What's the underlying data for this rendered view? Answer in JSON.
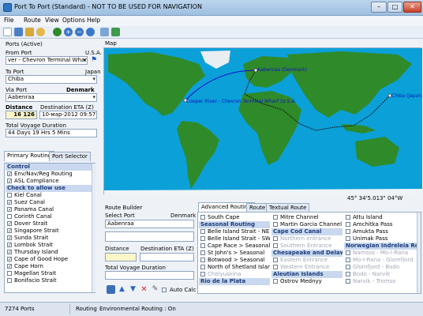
{
  "window": {
    "title": "Port To Port  (Standard)  - NOT TO BE USED FOR NAVIGATION",
    "min": "–",
    "max": "□",
    "close": "✕"
  },
  "menu": [
    "File",
    "Route",
    "View",
    "Options",
    "Help"
  ],
  "ports": {
    "section_label": "Ports (Active)",
    "from_label": "From Port",
    "from_country": "U.S.A.",
    "from_value": "ver - Chevron Terminal Wharf",
    "to_label": "To Port",
    "to_country": "Japan",
    "to_value": "Chiba",
    "via_label": "Via Port",
    "via_country": "Denmark",
    "via_value": "Aabenraa",
    "distance_label": "Distance",
    "distance_value": "16 126",
    "eta_label": "Destination ETA (Z)",
    "eta_value": "10-мар-2012 09:57",
    "duration_label": "Total Voyage Duration",
    "duration_value": "44 Days 19 Hrs 5 Mins"
  },
  "left_tabs": [
    "Primary Routing",
    "Port Selector"
  ],
  "routing_list": [
    {
      "label": "Control",
      "header": true
    },
    {
      "label": "Env/Nav/Reg Routing",
      "checked": true
    },
    {
      "label": "ASL Compliance",
      "checked": true
    },
    {
      "label": "Check to allow use",
      "header": true
    },
    {
      "label": "Kiel Canal",
      "checked": false
    },
    {
      "label": "Suez Canal",
      "checked": true
    },
    {
      "label": "Panama Canal",
      "checked": true
    },
    {
      "label": "Corinth Canal",
      "checked": false
    },
    {
      "label": "Dover Strait",
      "checked": true
    },
    {
      "label": "Singapore Strait",
      "checked": true
    },
    {
      "label": "Sunda Strait",
      "checked": true
    },
    {
      "label": "Lombok Strait",
      "checked": true
    },
    {
      "label": "Thursday Island",
      "checked": true
    },
    {
      "label": "Cape of Good Hope",
      "checked": true
    },
    {
      "label": "Cape Horn",
      "checked": true
    },
    {
      "label": "Magellan Strait",
      "checked": false
    },
    {
      "label": "Bonifacio Strait",
      "checked": false
    }
  ],
  "map": {
    "label": "Map",
    "coordinates": "45° 34'5.013\" 04°W",
    "port_labels": {
      "origin": "Cooper River - Chevron Terminal Wharf (U.S.A.",
      "via": "Aabenraa (Denmark)",
      "destination": "Chiba (Japan"
    }
  },
  "route_builder": {
    "label": "Route Builder",
    "select_port_label": "Select Port",
    "country": "Denmark",
    "port_value": "Aabenraa",
    "distance_label": "Distance",
    "eta_label": "Destination ETA (Z)",
    "duration_label": "Total Voyage Duration",
    "auto_calc_label": "Auto Calc"
  },
  "right_tabs": [
    "Advanced Routing",
    "Route",
    "Textual Route"
  ],
  "grid": {
    "col1": [
      {
        "label": "South Cape",
        "type": "item"
      },
      {
        "label": "Seasonal Routing",
        "type": "header"
      },
      {
        "label": "Belle Island Strait - NE Bound",
        "type": "item"
      },
      {
        "label": "Belle Island Strait - SW Bound",
        "type": "item"
      },
      {
        "label": "Cape Race > Seasonal",
        "type": "item"
      },
      {
        "label": "St John's > Seasonal",
        "type": "item"
      },
      {
        "label": "Botwood > Seasonal",
        "type": "item"
      },
      {
        "label": "North of Shetland Islands",
        "type": "item"
      },
      {
        "label": "Chelyuskina",
        "type": "disabled"
      },
      {
        "label": "Rio de la Plata",
        "type": "header"
      }
    ],
    "col2": [
      {
        "label": "Mitre Channel",
        "type": "item"
      },
      {
        "label": "Martin Garcia Channel",
        "type": "item"
      },
      {
        "label": "Cape Cod Canal",
        "type": "header"
      },
      {
        "label": "Northern entrance",
        "type": "disabled"
      },
      {
        "label": "Southern Entrance",
        "type": "disabled"
      },
      {
        "label": "Chesapeake and Delaware Canal",
        "type": "header"
      },
      {
        "label": "Eastern Entrance",
        "type": "disabled"
      },
      {
        "label": "Western Entrance",
        "type": "disabled"
      },
      {
        "label": "Aleutian Islands",
        "type": "header"
      },
      {
        "label": "Ostrov Mednyy",
        "type": "item"
      }
    ],
    "col3": [
      {
        "label": "Attu Island",
        "type": "item"
      },
      {
        "label": "Amchitka Pass",
        "type": "item"
      },
      {
        "label": "Amukta Pass",
        "type": "item"
      },
      {
        "label": "Unimak Pass",
        "type": "item"
      },
      {
        "label": "Norwegian Indreleia Routing",
        "type": "header"
      },
      {
        "label": "Namsos - Mo-I-Rana",
        "type": "disabled"
      },
      {
        "label": "Mo-I-Rana - Glomfjord",
        "type": "disabled"
      },
      {
        "label": "Glomfjord - Bodo",
        "type": "disabled"
      },
      {
        "label": "Bodo - Narvik",
        "type": "disabled"
      },
      {
        "label": "Narvik - Tromso",
        "type": "disabled"
      }
    ]
  },
  "status": {
    "ports": "7274 Ports",
    "mode": "Routing",
    "env": "Environmental Routing : On"
  },
  "colors": {
    "ocean": "#0ba0d8",
    "land": "#2f8a2a",
    "route": "#1010c8",
    "header_bg": "#c9d8ee"
  }
}
